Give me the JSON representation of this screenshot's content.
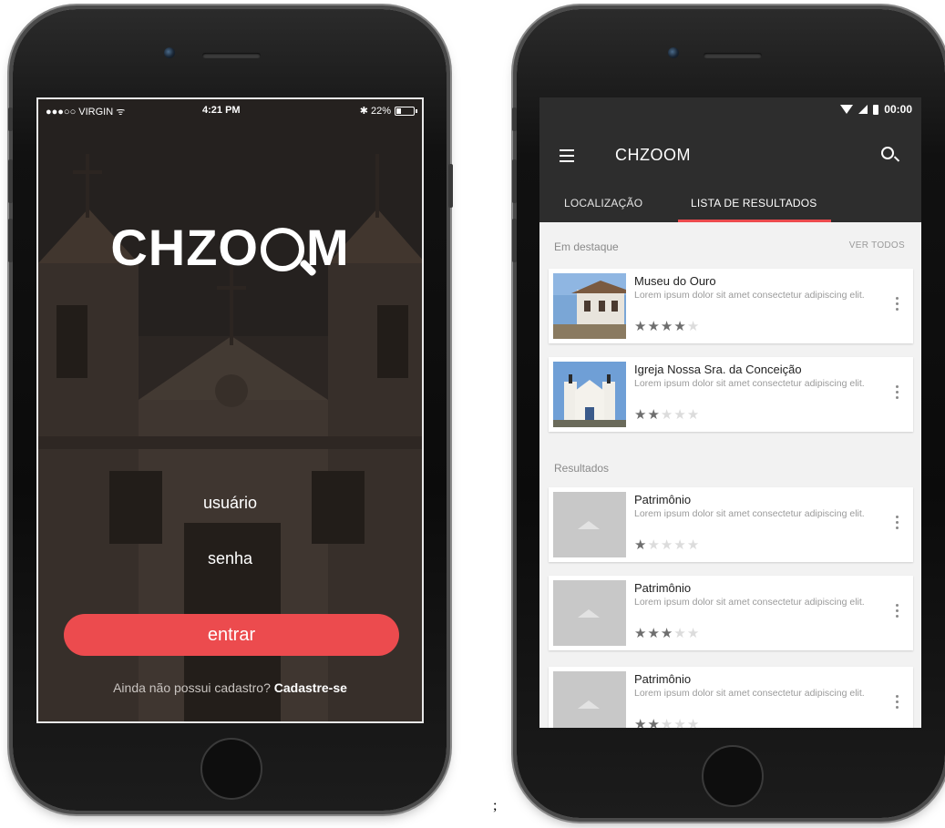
{
  "login": {
    "status": {
      "carrier": "●●●○○ VIRGIN ᯤ",
      "time": "4:21 PM",
      "battery": "✱ 22%"
    },
    "logo": {
      "prefix": "CHZO",
      "suffix": "M"
    },
    "username_label": "usuário",
    "password_label": "senha",
    "enter_label": "entrar",
    "signup_prompt": "Ainda não possui cadastro?",
    "signup_link": "Cadastre-se",
    "accent": "#ec4b4e"
  },
  "app": {
    "status_time": "00:00",
    "title": "CHZOOM",
    "tabs": [
      "LOCALIZAÇÃO",
      "LISTA DE RESULTADOS"
    ],
    "featured": {
      "heading": "Em destaque",
      "see_all": "VER TODOS",
      "items": [
        {
          "title": "Museu do Ouro",
          "desc": "Lorem ipsum dolor sit amet consectetur adipiscing elit.",
          "rating": 4,
          "max": 5
        },
        {
          "title": "Igreja Nossa Sra. da Conceição",
          "desc": "Lorem ipsum dolor sit amet consectetur adipiscing elit.",
          "rating": 2,
          "max": 5
        }
      ]
    },
    "results": {
      "heading": "Resultados",
      "items": [
        {
          "title": "Patrimônio",
          "desc": "Lorem ipsum dolor sit amet consectetur adipiscing elit.",
          "rating": 1,
          "max": 5
        },
        {
          "title": "Patrimônio",
          "desc": "Lorem ipsum dolor sit amet consectetur adipiscing elit.",
          "rating": 3,
          "max": 5
        },
        {
          "title": "Patrimônio",
          "desc": "Lorem ipsum dolor sit amet consectetur adipiscing elit.",
          "rating": 2,
          "max": 5
        }
      ]
    },
    "colors": {
      "header": "#2d2d2d",
      "accent": "#ec4b4e",
      "background": "#f2f2f2"
    }
  },
  "separator": ";"
}
